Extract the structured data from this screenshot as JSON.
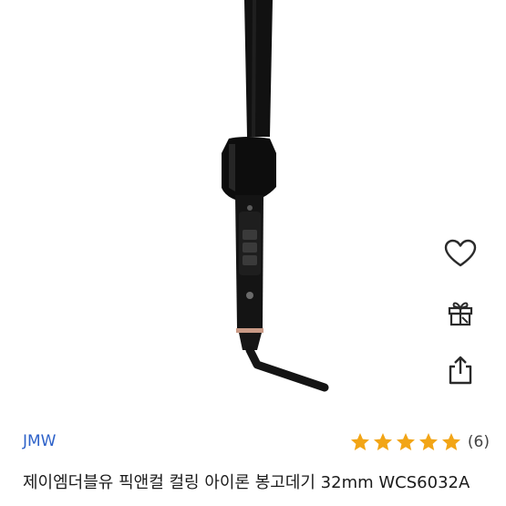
{
  "product": {
    "brand": "JMW",
    "rating": {
      "stars": 5,
      "max_stars": 5,
      "count_label": "(6)"
    },
    "title": "제이엠더블유 픽앤컬 컬링 아이론 봉고데기 32mm WCS6032A"
  },
  "colors": {
    "brand_link": "#2e62c9",
    "star": "#f2a516",
    "icon_stroke": "#2a2a2a",
    "product_body": "#111111"
  },
  "icons": [
    "heart-icon",
    "gift-icon",
    "share-icon"
  ]
}
